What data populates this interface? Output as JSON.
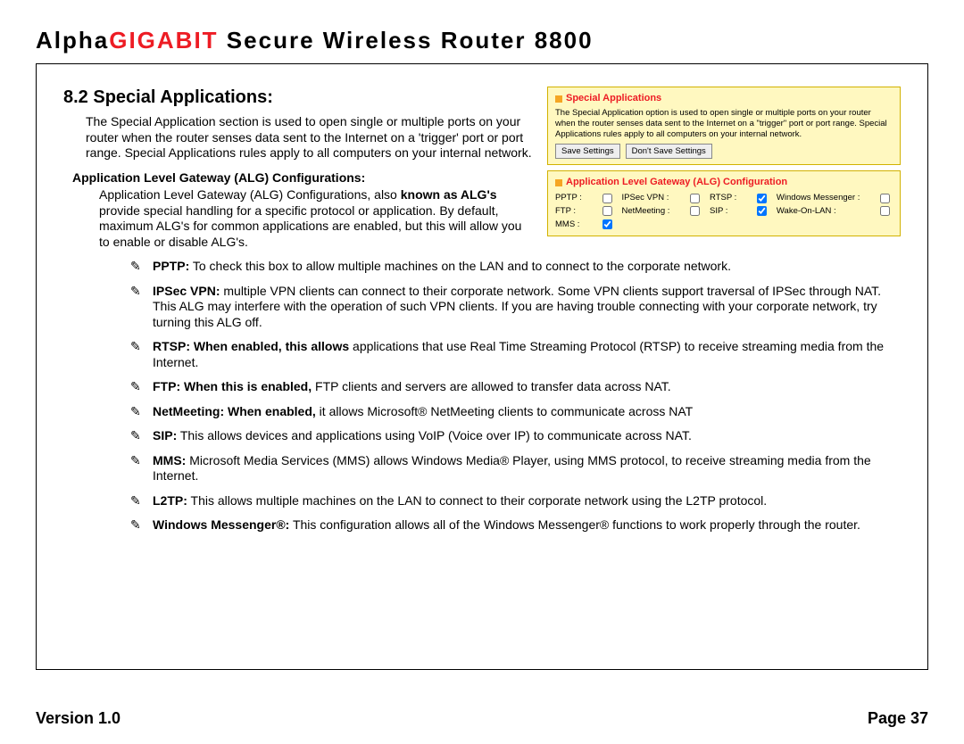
{
  "header": {
    "brand_prefix": "Alpha",
    "brand_highlight": "GIGABIT",
    "brand_suffix": " Secure Wireless Router 8800"
  },
  "section": {
    "heading": "8.2 Special Applications:",
    "intro": "The Special Application section is used to open single or multiple ports on your router when the router senses data sent to the Internet on a 'trigger' port  or port range. Special Applications rules apply to all computers on your internal network.",
    "subheading": "Application Level Gateway (ALG) Configurations:",
    "alg_intro_prefix": "Application Level Gateway (ALG) Configurations, also ",
    "alg_intro_bold": "known as ALG's",
    "alg_intro_suffix": " provide special handling for a specific protocol or application. By default, maximum ALG's for common applications are enabled, but this will allow you to enable or disable  ALG's."
  },
  "bullets": {
    "pptp_label": "PPTP:",
    "pptp_text": " To check this box to allow multiple machines on the LAN and to connect to the corporate network.",
    "ipsec_label": "IPSec VPN:",
    "ipsec_text": " multiple VPN clients can connect to their corporate network. Some VPN clients support traversal of IPSec through NAT. This ALG may interfere with the operation of such VPN clients. If you are having trouble connecting with your corporate network, try turning this ALG off.",
    "rtsp_label": "RTSP: When enabled, this allows",
    "rtsp_text": " applications that use Real Time Streaming Protocol (RTSP) to receive streaming media from the Internet.",
    "ftp_label": "FTP: When this is enabled,",
    "ftp_text": " FTP clients and servers are allowed to transfer data across NAT.",
    "netm_label": "NetMeeting: When enabled,",
    "netm_text": " it allows Microsoft® NetMeeting clients to communicate across NAT",
    "sip_label": "SIP:",
    "sip_text": " This allows devices and applications using VoIP (Voice over IP) to communicate across NAT.",
    "mms_label": "MMS:",
    "mms_text": "  Microsoft Media Services (MMS) allows Windows Media® Player, using MMS protocol, to receive streaming media from the Internet.",
    "l2tp_label": "L2TP:",
    "l2tp_text": " This allows multiple machines on the LAN to connect to their corporate network using the L2TP protocol.",
    "wm_label": "Windows Messenger®:",
    "wm_text": " This configuration allows all of the Windows Messenger® functions to work properly through the router."
  },
  "panel1": {
    "title": "Special Applications",
    "desc": "The Special Application option is used to open single or multiple ports on your router when the router senses data sent to the Internet on a \"trigger\" port or port range. Special Applications rules apply to all computers on your internal network.",
    "save": "Save Settings",
    "dont_save": "Don't Save Settings"
  },
  "panel2": {
    "title": "Application Level Gateway (ALG) Configuration",
    "items": {
      "pptp": "PPTP :",
      "ipsec": "IPSec VPN :",
      "rtsp": "RTSP :",
      "winmsg": "Windows Messenger :",
      "ftp": "FTP :",
      "netm": "NetMeeting :",
      "sip": "SIP :",
      "wol": "Wake-On-LAN :",
      "mms": "MMS :"
    }
  },
  "footer": {
    "version": "Version 1.0",
    "page": "Page 37"
  }
}
